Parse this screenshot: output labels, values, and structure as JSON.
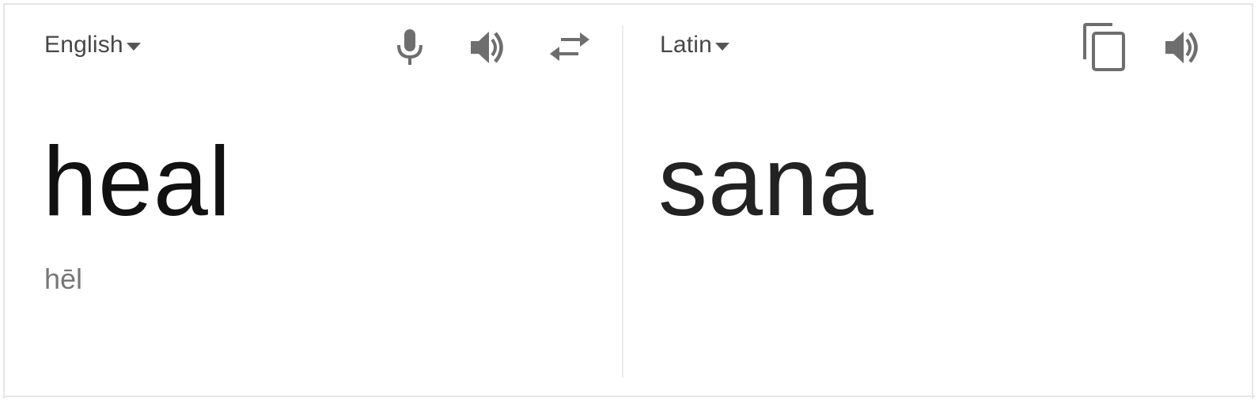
{
  "source": {
    "language": "English",
    "text": "heal",
    "phonetic": "hēl"
  },
  "target": {
    "language": "Latin",
    "text": "sana"
  },
  "icons": {
    "microphone": "microphone-icon",
    "speaker": "speaker-icon",
    "swap": "swap-languages-icon",
    "copy": "copy-icon"
  },
  "colors": {
    "icon": "#6e6e6e",
    "border": "#e6e6e6",
    "text_dark": "#111111",
    "text_muted": "#777777"
  }
}
